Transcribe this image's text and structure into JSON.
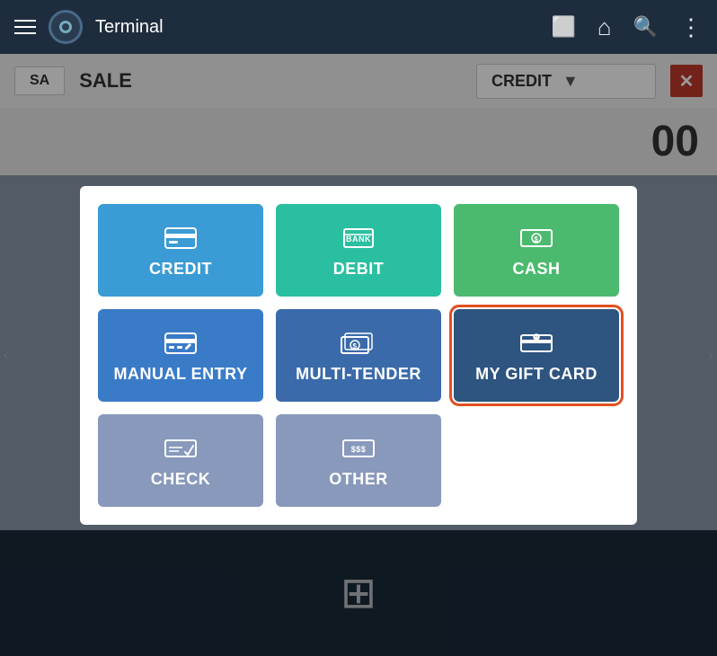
{
  "navbar": {
    "title": "Terminal",
    "hamburger_label": "hamburger",
    "icons": {
      "tablet": "⬜",
      "home": "⌂",
      "search": "🔍",
      "more": "⋮"
    }
  },
  "sale_header": {
    "tab_label": "SA",
    "sale_label": "SALE",
    "dropdown_value": "CREDIT",
    "close_label": "✕"
  },
  "amount": {
    "value": "00"
  },
  "payment_options": [
    {
      "id": "credit",
      "label": "CREDIT",
      "icon": "credit",
      "style": "credit"
    },
    {
      "id": "debit",
      "label": "DEBIT",
      "icon": "debit",
      "style": "debit"
    },
    {
      "id": "cash",
      "label": "CASH",
      "icon": "cash",
      "style": "cash"
    },
    {
      "id": "manual",
      "label": "MANUAL ENTRY",
      "icon": "manual",
      "style": "manual"
    },
    {
      "id": "multi",
      "label": "MULTI-TENDER",
      "icon": "multi",
      "style": "multi"
    },
    {
      "id": "gift",
      "label": "MY GIFT CARD",
      "icon": "gift",
      "style": "gift"
    },
    {
      "id": "check",
      "label": "CHECK",
      "icon": "check",
      "style": "check"
    },
    {
      "id": "other",
      "label": "OTHER",
      "icon": "other",
      "style": "other"
    }
  ],
  "bottom_icon": "⊞"
}
